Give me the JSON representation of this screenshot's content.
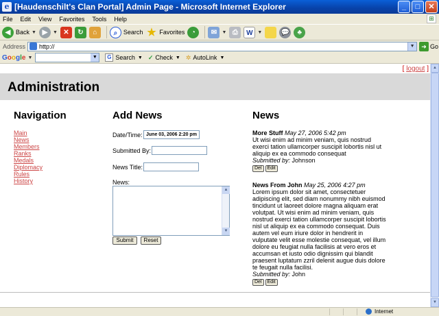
{
  "window": {
    "title": "[Haudenschilt's Clan Portal] Admin Page - Microsoft Internet Explorer",
    "minimize": "_",
    "maximize": "□",
    "close": "✕"
  },
  "menu": {
    "items": [
      "File",
      "Edit",
      "View",
      "Favorites",
      "Tools",
      "Help"
    ]
  },
  "toolbar": {
    "back_label": "Back",
    "search_label": "Search",
    "favorites_label": "Favorites"
  },
  "address": {
    "label": "Address",
    "value": "http://",
    "go_label": "Go"
  },
  "google": {
    "logo": "Google",
    "search_label": "Search",
    "check_label": "Check",
    "autolink_label": "AutoLink"
  },
  "page": {
    "logout": "logout",
    "heading": "Administration",
    "nav_title": "Navigation",
    "nav_items": [
      "Main",
      "News",
      "Members",
      "Ranks",
      "Medals",
      "Diplomacy",
      "Rules",
      "History"
    ],
    "add_news": {
      "title": "Add News",
      "date_label": "Date/Time:",
      "date_value": "June 03, 2006 2:20 pm",
      "submitted_label": "Submitted By:",
      "title_label": "News Title:",
      "news_label": "News:",
      "submit_label": "Submit",
      "reset_label": "Reset"
    },
    "news": {
      "title": "News",
      "items": [
        {
          "title": "More Stuff",
          "date": "May 27, 2006 5:42 pm",
          "body": "Ut wisi enim ad minim veniam, quis nostrud exerci tation ullamcorper suscipit lobortis nisl ut aliquip ex ea commodo consequat",
          "submitted_label": "Submitted by:",
          "author": "Johnson",
          "del_label": "Del",
          "edit_label": "Edit"
        },
        {
          "title": "News From John",
          "date": "May 25, 2006 4:27 pm",
          "body": "Lorem ipsum dolor sit amet, consectetuer adipiscing elit, sed diam nonummy nibh euismod tincidunt ut laoreet dolore magna aliquam erat volutpat. Ut wisi enim ad minim veniam, quis nostrud exerci tation ullamcorper suscipit lobortis nisl ut aliquip ex ea commodo consequat. Duis autem vel eum iriure dolor in hendrerit in vulputate velit esse molestie consequat, vel illum dolore eu feugiat nulla facilisis at vero eros et accumsan et iusto odio dignissim qui blandit praesent luptatum zzril delenit augue duis dolore te feugait nulla facilisi.",
          "submitted_label": "Submitted by:",
          "author": "John",
          "del_label": "Del",
          "edit_label": "Edit"
        }
      ]
    }
  },
  "status": {
    "zone": "Internet"
  },
  "colors": {
    "link": "#c44444",
    "banner": "#d9d9d9"
  }
}
